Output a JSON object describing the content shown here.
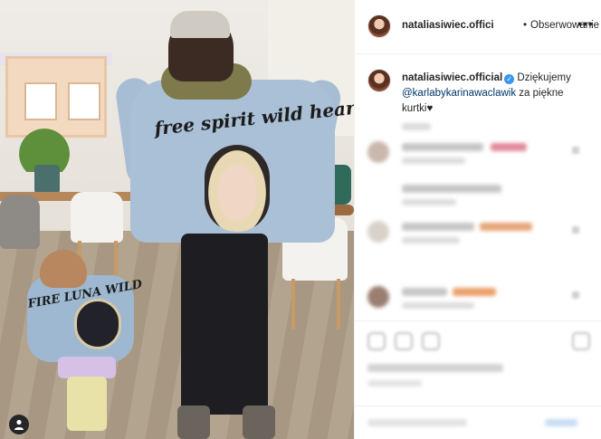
{
  "post": {
    "jacket_text_woman": "free spirit wild heart",
    "jacket_text_child": "FIRE LUNA WILD"
  },
  "header": {
    "username": "nataliasiwiec.offici",
    "separator": "•",
    "follow_label": "Obserwowanie",
    "more_label": "•••"
  },
  "caption": {
    "username": "nataliasiwiec.official",
    "verified_mark": "✓",
    "text_before": " Dziękujemy ",
    "mention": "@karlabykarinawaclawik",
    "text_after": " za piękne kurtki♥"
  },
  "colors": {
    "link": "#003569",
    "verified": "#3897f0",
    "border": "#efefef",
    "text": "#262626"
  },
  "icons": [
    "user-tag-icon",
    "more-options-icon",
    "verified-badge-icon"
  ]
}
